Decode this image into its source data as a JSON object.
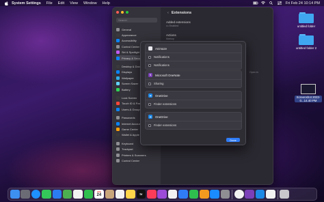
{
  "menubar": {
    "app_name": "System Settings",
    "menus": [
      "File",
      "Edit",
      "View",
      "Window",
      "Help"
    ],
    "clock": "Fri Feb 24  10:14 PM"
  },
  "settings": {
    "search_placeholder": "Search",
    "title": "Extensions",
    "sidebar_items": [
      {
        "label": "General",
        "color": "#8e8e93"
      },
      {
        "label": "Appearance",
        "color": "#3a3a3c"
      },
      {
        "label": "Accessibility",
        "color": "#0a84ff"
      },
      {
        "label": "Control Center",
        "color": "#8e8e93"
      },
      {
        "label": "Siri & Spotlight",
        "color": "#bf5af2"
      },
      {
        "label": "Privacy & Security",
        "color": "#0a84ff"
      },
      {
        "label": "Desktop & Dock",
        "color": "#3a3a3c"
      },
      {
        "label": "Displays",
        "color": "#0a84ff"
      },
      {
        "label": "Wallpaper",
        "color": "#32ade6"
      },
      {
        "label": "Screen Saver",
        "color": "#64d2ff"
      },
      {
        "label": "Battery",
        "color": "#30d158"
      },
      {
        "label": "Lock Screen",
        "color": "#3a3a3c"
      },
      {
        "label": "Touch ID & Password",
        "color": "#ff453a"
      },
      {
        "label": "Users & Groups",
        "color": "#0a84ff"
      },
      {
        "label": "Passwords",
        "color": "#8e8e93"
      },
      {
        "label": "Internet Accounts",
        "color": "#0a84ff"
      },
      {
        "label": "Game Center",
        "color": "#ff9f0a"
      },
      {
        "label": "Wallet & Apple Pay",
        "color": "#3a3a3c"
      },
      {
        "label": "Keyboard",
        "color": "#8e8e93"
      },
      {
        "label": "Trackpad",
        "color": "#8e8e93"
      },
      {
        "label": "Printers & Scanners",
        "color": "#8e8e93"
      },
      {
        "label": "Control Center",
        "color": "#8e8e93"
      }
    ],
    "selected_index": 5,
    "content_rows": [
      {
        "label": "Added extensions",
        "sub": "••• Enabled"
      },
      {
        "label": "Actions",
        "sub": "Markup"
      }
    ],
    "partial_text": "Open in"
  },
  "sheet": {
    "extensions": [
      {
        "app": "Animaze",
        "icon_color": "#e8e8ee",
        "rows": [
          "Notifications",
          "Notifications"
        ]
      },
      {
        "app": "Microsoft OneNote",
        "icon_color": "#7b3fb8",
        "rows": [
          "Sharing"
        ]
      },
      {
        "app": "OneDrive",
        "icon_color": "#1e88e5",
        "rows": [
          "Finder extensions"
        ]
      },
      {
        "app": "OneDrive",
        "icon_color": "#1e88e5",
        "rows": [
          "Finder extensions"
        ]
      }
    ],
    "done_label": "Done"
  },
  "desktop": {
    "folders": [
      "untitled folder",
      "untitled folder 2"
    ],
    "screenshot": "Screenshot 2023-0...14.40 PM"
  },
  "dock": {
    "apps": [
      {
        "name": "finder-icon",
        "color": "#3d8ff0"
      },
      {
        "name": "launchpad-icon",
        "color": "#6b6b75"
      },
      {
        "name": "safari-icon",
        "color": "#1e90ff"
      },
      {
        "name": "messages-icon",
        "color": "#34c759"
      },
      {
        "name": "mail-icon",
        "color": "#2a7cf0"
      },
      {
        "name": "maps-icon",
        "color": "#4cb050"
      },
      {
        "name": "photos-icon",
        "color": "#f2f2f2"
      },
      {
        "name": "facetime-icon",
        "color": "#2fbf4f"
      },
      {
        "name": "calendar-icon",
        "color": "#ffffff"
      },
      {
        "name": "contacts-icon",
        "color": "#c9a57b"
      },
      {
        "name": "reminders-icon",
        "color": "#f2f2f2"
      },
      {
        "name": "notes-icon",
        "color": "#ffd54a"
      },
      {
        "name": "tv-icon",
        "color": "#111111"
      },
      {
        "name": "music-icon",
        "color": "#fa3c58"
      },
      {
        "name": "podcasts-icon",
        "color": "#9b4bd8"
      },
      {
        "name": "news-icon",
        "color": "#f2f2f2"
      },
      {
        "name": "keynote-icon",
        "color": "#2f7cf6"
      },
      {
        "name": "numbers-icon",
        "color": "#2fbf4f"
      },
      {
        "name": "pages-icon",
        "color": "#f29a1f"
      },
      {
        "name": "app-store-icon",
        "color": "#1a8cff"
      },
      {
        "name": "system-settings-icon",
        "color": "#8e8e93"
      },
      {
        "name": "chrome-icon",
        "color": "#f2f2f2"
      },
      {
        "name": "onenote-icon",
        "color": "#7b3fb8"
      },
      {
        "name": "onedrive-icon",
        "color": "#1e88e5"
      },
      {
        "name": "preview-icon",
        "color": "#f2f2f2"
      },
      {
        "name": "trash-icon",
        "color": "#c7c7cc"
      }
    ],
    "calendar_month": "FEB",
    "calendar_day": "24",
    "tv_label": "tv"
  }
}
